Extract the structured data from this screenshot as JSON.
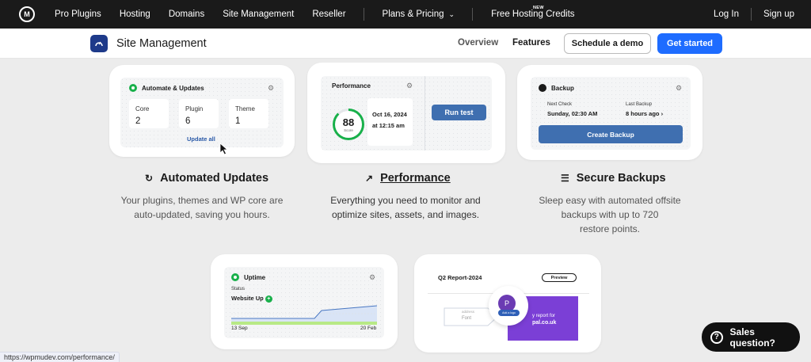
{
  "nav": {
    "logo": "M",
    "items": [
      "Pro Plugins",
      "Hosting",
      "Domains",
      "Site Management",
      "Reseller"
    ],
    "plans": "Plans & Pricing",
    "credits": "Free Hosting Credits",
    "new_badge": "NEW",
    "login": "Log In",
    "signup": "Sign up"
  },
  "subheader": {
    "title": "Site Management",
    "overview": "Overview",
    "features": "Features",
    "demo": "Schedule a demo",
    "started": "Get started"
  },
  "updates_card": {
    "title": "Automate & Updates",
    "tiles": [
      {
        "label": "Core",
        "value": "2"
      },
      {
        "label": "Plugin",
        "value": "6"
      },
      {
        "label": "Theme",
        "value": "1"
      }
    ],
    "update_all": "Update all"
  },
  "performance_card": {
    "title": "Performance",
    "score": "88",
    "score_label": "Score",
    "score_fraction": 0.88,
    "date": "Oct 16, 2024",
    "time": "at 12:15 am",
    "run": "Run test"
  },
  "backup_card": {
    "title": "Backup",
    "next_label": "Next Check",
    "next_value": "Sunday, 02:30 AM",
    "last_label": "Last Backup",
    "last_value": "8 hours ago",
    "create": "Create Backup"
  },
  "features": [
    {
      "title": "Automated Updates",
      "desc1": "Your plugins, themes and WP core are",
      "desc2": "auto-updated, saving you hours.",
      "desc3": ""
    },
    {
      "title": "Performance",
      "desc1": "Everything you need to monitor and",
      "desc2": "optimize sites, assets, and images.",
      "desc3": ""
    },
    {
      "title": "Secure Backups",
      "desc1": "Sleep easy with automated offsite",
      "desc2": "backups with up to 720",
      "desc3": "restore points."
    }
  ],
  "uptime_card": {
    "title": "Uptime",
    "status_label": "Status",
    "status_value": "Website Up",
    "start": "13 Sep",
    "end": "20 Feb"
  },
  "report_card": {
    "title": "Q2 Report-2024",
    "preview": "Preview",
    "avatar": "P",
    "add_logo": "Add a logo",
    "field_small": "address",
    "field": "Font",
    "purple_line1": "y report for",
    "purple_line2": "pal.co.uk"
  },
  "sales": "Sales question?",
  "status_url": "https://wpmudev.com/performance/",
  "colors": {
    "accent": "#1e6cff",
    "green": "#18b04a",
    "button": "#3f6fb0",
    "purple": "#7b3fd6"
  }
}
